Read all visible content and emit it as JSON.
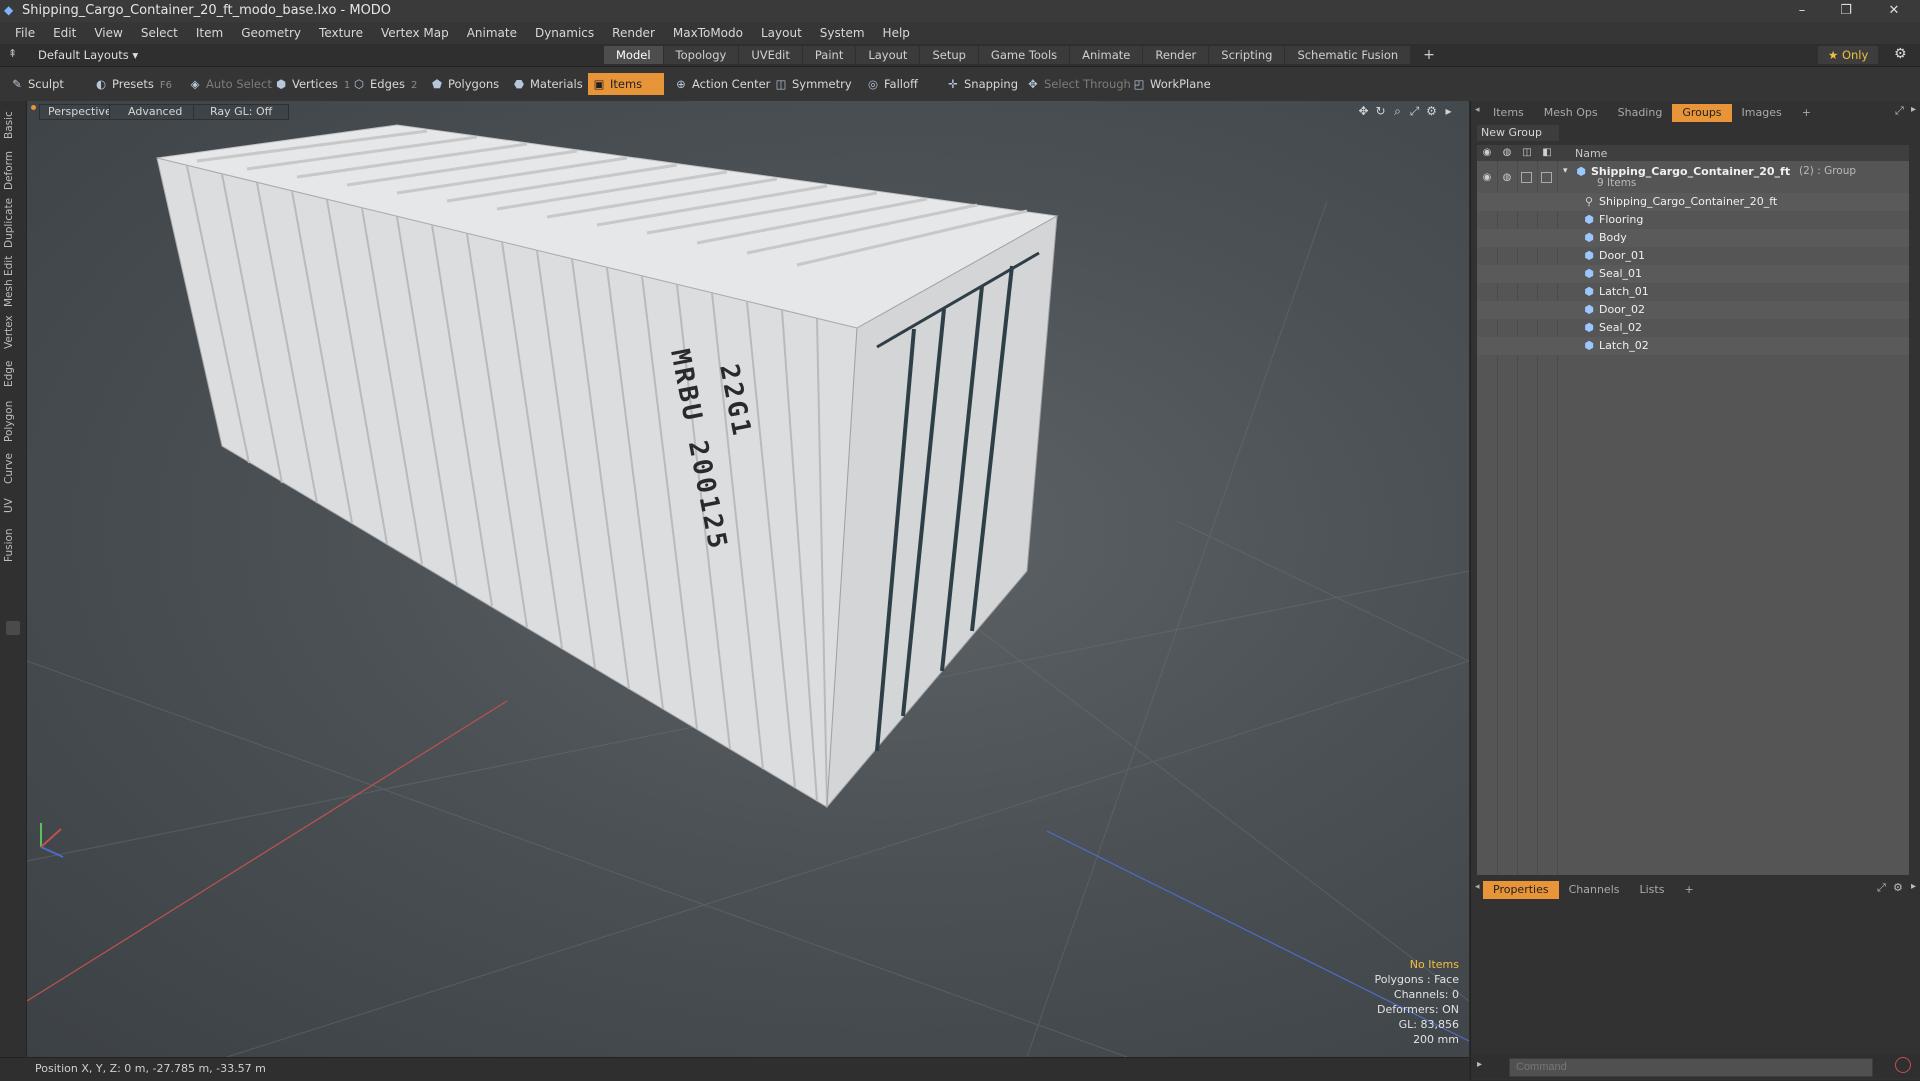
{
  "window": {
    "title": "Shipping_Cargo_Container_20_ft_modo_base.lxo - MODO",
    "minimize": "–",
    "restore": "❐",
    "close": "✕"
  },
  "menu": [
    "File",
    "Edit",
    "View",
    "Select",
    "Item",
    "Geometry",
    "Texture",
    "Vertex Map",
    "Animate",
    "Dynamics",
    "Render",
    "MaxToModo",
    "Layout",
    "System",
    "Help"
  ],
  "layout": {
    "default_layouts": "Default Layouts ▾",
    "tabs": [
      "Model",
      "Topology",
      "UVEdit",
      "Paint",
      "Layout",
      "Setup",
      "Game Tools",
      "Animate",
      "Render",
      "Scripting",
      "Schematic Fusion"
    ],
    "active_tab": "Model",
    "add": "+",
    "only": "★  Only",
    "settings_icon": "gear-icon"
  },
  "toolbar": {
    "sculpt": "Sculpt",
    "presets": "Presets",
    "presets_key": "F6",
    "auto_select": "Auto Select",
    "vertices": "Vertices",
    "vertices_num": "1",
    "edges": "Edges",
    "edges_num": "2",
    "polygons": "Polygons",
    "materials": "Materials",
    "items": "Items",
    "action_center": "Action Center",
    "symmetry": "Symmetry",
    "falloff": "Falloff",
    "snapping": "Snapping",
    "select_through": "Select Through",
    "workplane": "WorkPlane"
  },
  "left_tabs": [
    "Basic",
    "Deform",
    "Duplicate",
    "Mesh Edit",
    "Vertex",
    "Edge",
    "Polygon",
    "Curve",
    "UV",
    "Fusion"
  ],
  "viewport": {
    "perspective": "Perspective",
    "advanced": "Advanced",
    "raygl": "Ray GL: Off",
    "container_text_left": "MRBU 200125",
    "container_text_right": "22G1",
    "stats": {
      "no_items": "No Items",
      "polygons": "Polygons : Face",
      "channels": "Channels: 0",
      "deformers": "Deformers: ON",
      "gl": "GL: 83,856",
      "scale": "200 mm"
    }
  },
  "status": {
    "position": "Position X, Y, Z:  0 m, -27.785 m, -33.57 m"
  },
  "right_panel": {
    "tabs": [
      "Items",
      "Mesh Ops",
      "Shading",
      "Groups",
      "Images"
    ],
    "active_tab": "Groups",
    "add": "+",
    "new_group": "New Group",
    "name_header": "Name",
    "group": {
      "name": "Shipping_Cargo_Container_20_ft",
      "suffix": "(2) : Group",
      "count": "9 Items"
    },
    "children": [
      "Shipping_Cargo_Container_20_ft",
      "Flooring",
      "Body",
      "Door_01",
      "Seal_01",
      "Latch_01",
      "Door_02",
      "Seal_02",
      "Latch_02"
    ],
    "bottom_tabs": [
      "Properties",
      "Channels",
      "Lists"
    ],
    "bottom_active": "Properties",
    "command_placeholder": "Command"
  }
}
